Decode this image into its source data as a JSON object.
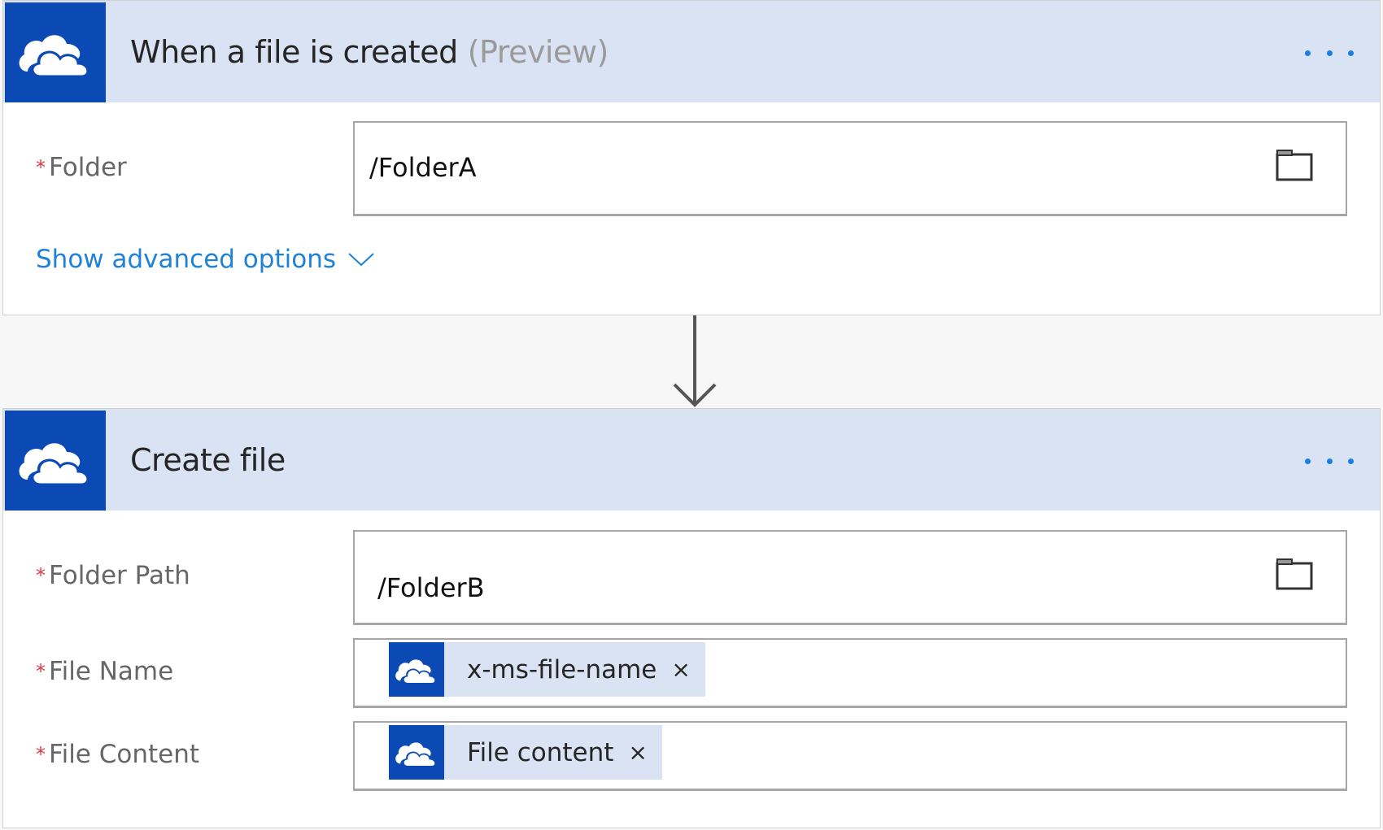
{
  "colors": {
    "header_bg": "#dae3f3",
    "icon_bg": "#0b49b4",
    "link": "#1f82d6",
    "required": "#e0394a",
    "more_dots": "#1a7de0"
  },
  "trigger_card": {
    "icon": "onedrive-cloud-icon",
    "title": "When a file is created",
    "title_suffix": "(Preview)",
    "more_icon": "ellipsis-icon",
    "fields": [
      {
        "label": "Folder",
        "required_marker": "*",
        "value": "/FolderA",
        "picker_icon": "folder-icon"
      }
    ],
    "advanced_link": "Show advanced options",
    "advanced_icon": "chevron-down-icon"
  },
  "connector": {
    "icon": "arrow-down-icon"
  },
  "action_card": {
    "icon": "onedrive-cloud-icon",
    "title": "Create file",
    "more_icon": "ellipsis-icon",
    "fields": [
      {
        "label": "Folder Path",
        "required_marker": "*",
        "value": "/FolderB",
        "picker_icon": "folder-icon"
      },
      {
        "label": "File Name",
        "required_marker": "*",
        "token": {
          "label": "x-ms-file-name",
          "remove": "×",
          "icon": "onedrive-cloud-icon"
        }
      },
      {
        "label": "File Content",
        "required_marker": "*",
        "token": {
          "label": "File content",
          "remove": "×",
          "icon": "onedrive-cloud-icon"
        }
      }
    ]
  }
}
